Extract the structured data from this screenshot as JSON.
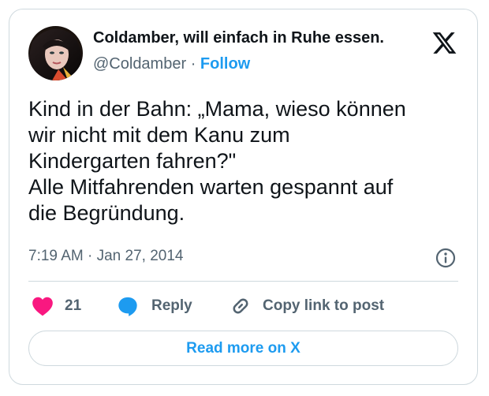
{
  "author": {
    "display_name": "Coldamber, will einfach in Ruhe essen.",
    "handle": "@Coldamber",
    "separator": "·",
    "follow_label": "Follow"
  },
  "tweet": {
    "lines": [
      "Kind in der Bahn: „Mama, wieso können",
      "wir nicht mit dem Kanu zum",
      "Kindergarten fahren?\"",
      "Alle Mitfahrenden warten gespannt auf",
      "die Begründung."
    ],
    "timestamp": "7:19 AM · Jan 27, 2014"
  },
  "actions": {
    "like_count": "21",
    "reply_label": "Reply",
    "copy_label": "Copy link to post"
  },
  "footer": {
    "read_more_label": "Read more on X"
  },
  "icons": {
    "logo": "x-logo-icon",
    "info": "info-icon",
    "like": "heart-icon",
    "reply": "speech-bubble-icon",
    "copy": "link-icon"
  },
  "colors": {
    "accent": "#1d9bf0",
    "like": "#f91880",
    "text": "#0f1419",
    "muted": "#536471",
    "border": "#cfd9de"
  }
}
